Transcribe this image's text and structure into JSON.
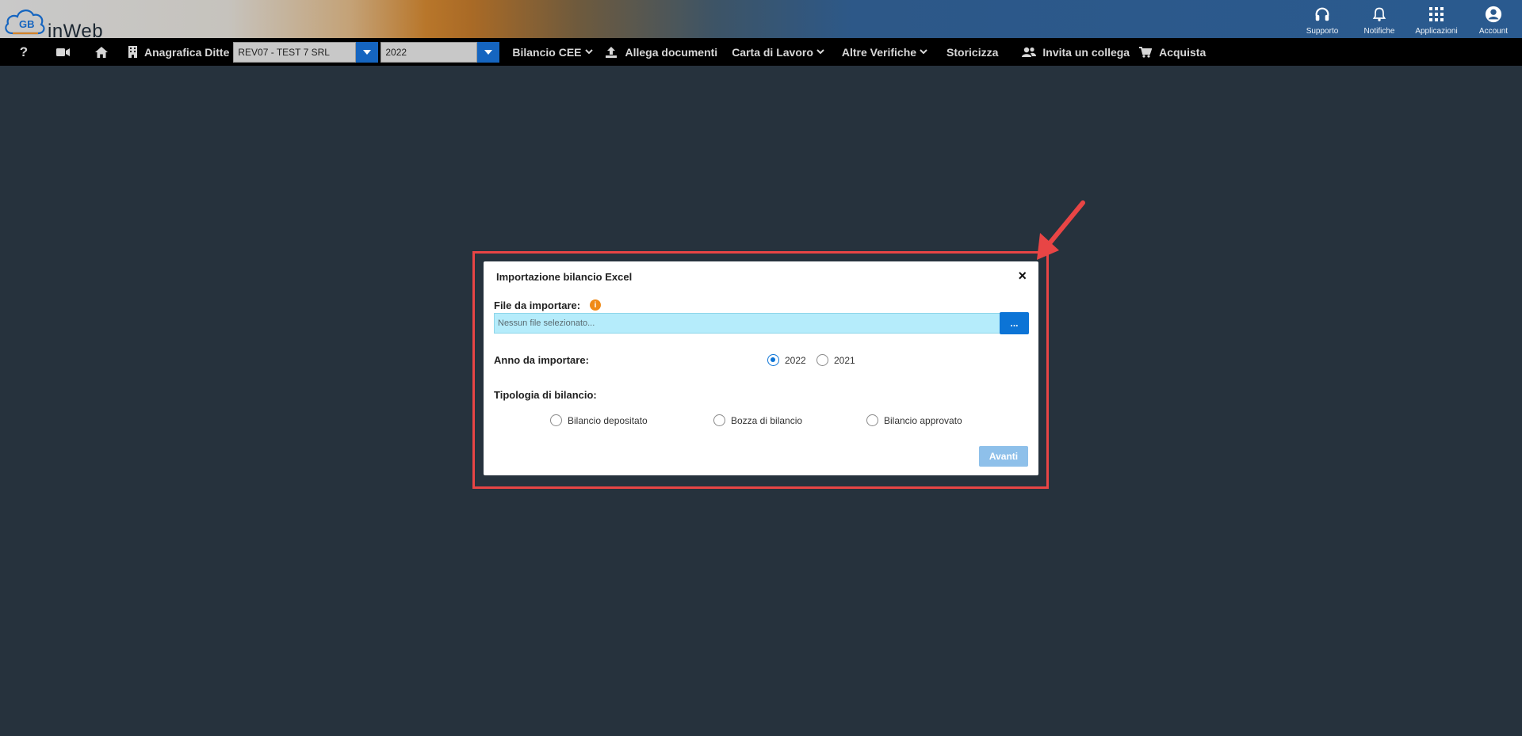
{
  "app": {
    "logo_text": "inWeb"
  },
  "top_actions": [
    {
      "label": "Supporto",
      "icon": "headset-icon"
    },
    {
      "label": "Notifiche",
      "icon": "bell-icon"
    },
    {
      "label": "Applicazioni",
      "icon": "grid-icon"
    },
    {
      "label": "Account",
      "icon": "account-icon"
    }
  ],
  "navbar": {
    "help_label": "?",
    "company_label": "Anagrafica Ditte",
    "company_value": "REV07 - TEST 7 SRL",
    "year_value": "2022",
    "items": [
      {
        "label": "Bilancio CEE"
      },
      {
        "label": "Allega documenti"
      },
      {
        "label": "Carta di Lavoro"
      },
      {
        "label": "Altre Verifiche"
      },
      {
        "label": "Storicizza"
      },
      {
        "label": "Invita un collega"
      },
      {
        "label": "Acquista"
      }
    ]
  },
  "modal": {
    "title": "Importazione bilancio Excel",
    "close_label": "×",
    "file_label": "File da importare:",
    "file_placeholder": "Nessun file selezionato...",
    "browse_label": "...",
    "year_label": "Anno da importare:",
    "year_options": [
      {
        "label": "2022",
        "selected": true
      },
      {
        "label": "2021",
        "selected": false
      }
    ],
    "type_label": "Tipologia di bilancio:",
    "type_options": [
      {
        "label": "Bilancio depositato"
      },
      {
        "label": "Bozza di bilancio"
      },
      {
        "label": "Bilancio approvato"
      }
    ],
    "next_label": "Avanti"
  },
  "colors": {
    "accent": "#0c74d6",
    "highlight": "#e84545",
    "background": "#26323d",
    "file_input_bg": "#b5ecfb"
  }
}
